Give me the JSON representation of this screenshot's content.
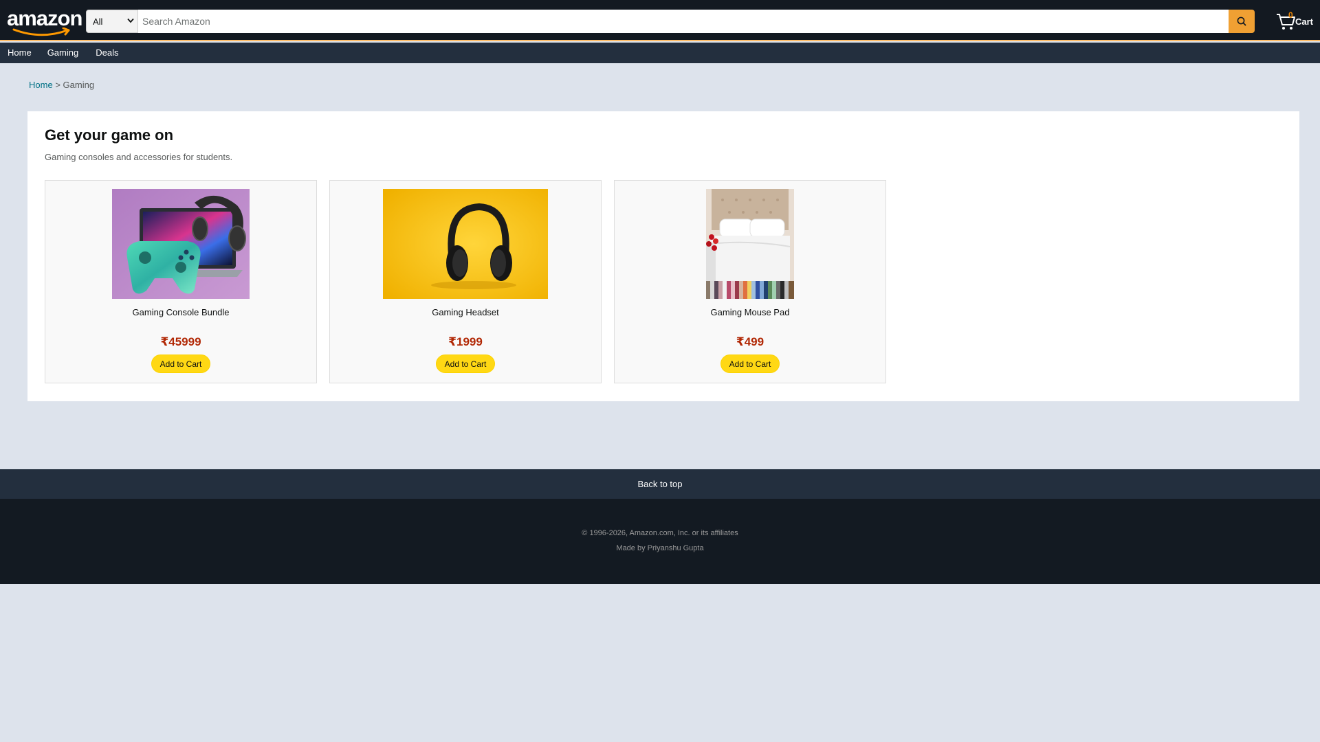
{
  "header": {
    "logo_text": "amazon",
    "search": {
      "category": "All",
      "placeholder": "Search Amazon",
      "value": ""
    },
    "cart": {
      "count": "0",
      "label": "Cart"
    }
  },
  "nav": {
    "items": [
      "Home",
      "Gaming",
      "Deals"
    ]
  },
  "breadcrumb": {
    "home": "Home",
    "separator": ">",
    "current": "Gaming"
  },
  "main": {
    "title": "Get your game on",
    "subtitle": "Gaming consoles and accessories for students.",
    "products": [
      {
        "name": "Gaming Console Bundle",
        "price": "₹45999",
        "button": "Add to Cart",
        "image_icon": "console-bundle-image"
      },
      {
        "name": "Gaming Headset",
        "price": "₹1999",
        "button": "Add to Cart",
        "image_icon": "headset-image"
      },
      {
        "name": "Gaming Mouse Pad",
        "price": "₹499",
        "button": "Add to Cart",
        "image_icon": "bedding-image"
      }
    ]
  },
  "footer": {
    "back_to_top": "Back to top",
    "copyright": "© 1996-2026, Amazon.com, Inc. or its affiliates",
    "made_by": "Made by Priyanshu Gupta"
  },
  "colors": {
    "header_bg": "#131921",
    "nav_bg": "#232f3e",
    "accent": "#febd69",
    "search_button": "#f0a033",
    "price": "#b12704",
    "add_to_cart": "#ffd814",
    "page_bg": "#dde3ec"
  }
}
